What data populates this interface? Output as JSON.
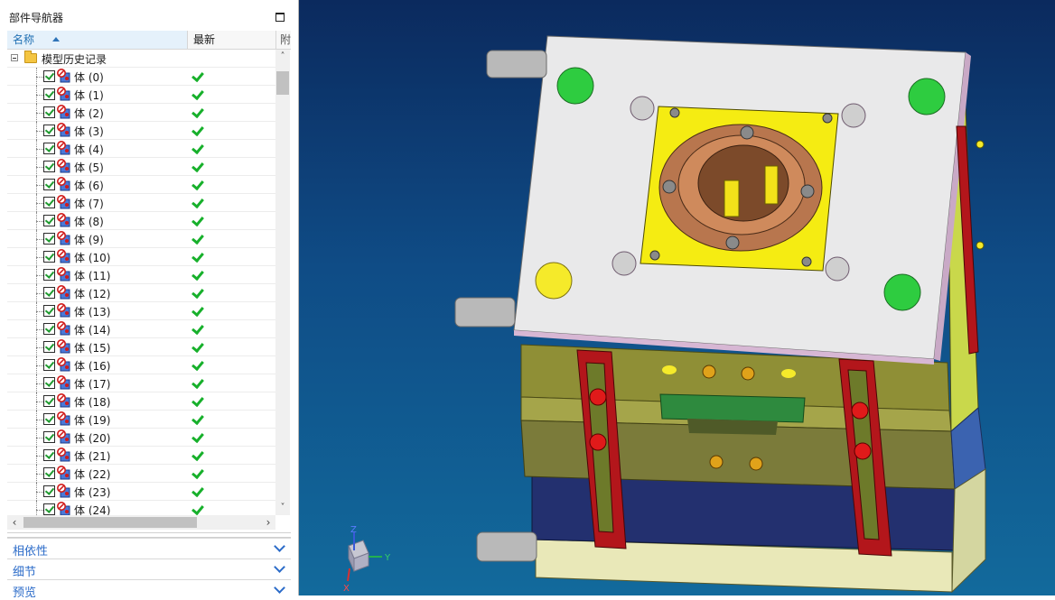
{
  "navigator": {
    "title": "部件导航器",
    "columns": {
      "name": "名称",
      "latest": "最新",
      "extra": "附"
    },
    "root_label": "模型历史记录",
    "items": [
      "体 (0)",
      "体 (1)",
      "体 (2)",
      "体 (3)",
      "体 (4)",
      "体 (5)",
      "体 (6)",
      "体 (7)",
      "体 (8)",
      "体 (9)",
      "体 (10)",
      "体 (11)",
      "体 (12)",
      "体 (13)",
      "体 (14)",
      "体 (15)",
      "体 (16)",
      "体 (17)",
      "体 (18)",
      "体 (19)",
      "体 (20)",
      "体 (21)",
      "体 (22)",
      "体 (23)",
      "体 (24)"
    ],
    "scroll_up": "˄",
    "scroll_down": "˅",
    "scroll_left": "‹",
    "scroll_right": "›",
    "sections": [
      "相依性",
      "细节",
      "预览"
    ]
  },
  "viewport": {
    "triad": {
      "x": "X",
      "y": "Y",
      "z": "Z"
    }
  },
  "colors": {
    "accent": "#2c6cc9",
    "check": "#17b02b",
    "viewport_top": "#0b2a5e",
    "viewport_bottom": "#126a9c"
  }
}
